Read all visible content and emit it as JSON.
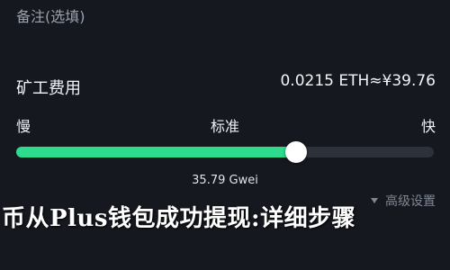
{
  "note": {
    "label": "备注(选填)"
  },
  "fee": {
    "label": "矿工费用",
    "value": "0.0215 ETH≈¥39.76"
  },
  "speed": {
    "slow_label": "慢",
    "standard_label": "标准",
    "fast_label": "快",
    "level_fraction": 0.67,
    "gas_value": "35.79 Gwei"
  },
  "advanced": {
    "label": "高级设置"
  },
  "overlay": {
    "title": "币从Plus钱包成功提现:详细步骤"
  },
  "colors": {
    "background": "#15181e",
    "accent": "#2edb8c",
    "track": "#2d313a",
    "thumb": "#ffffff"
  }
}
